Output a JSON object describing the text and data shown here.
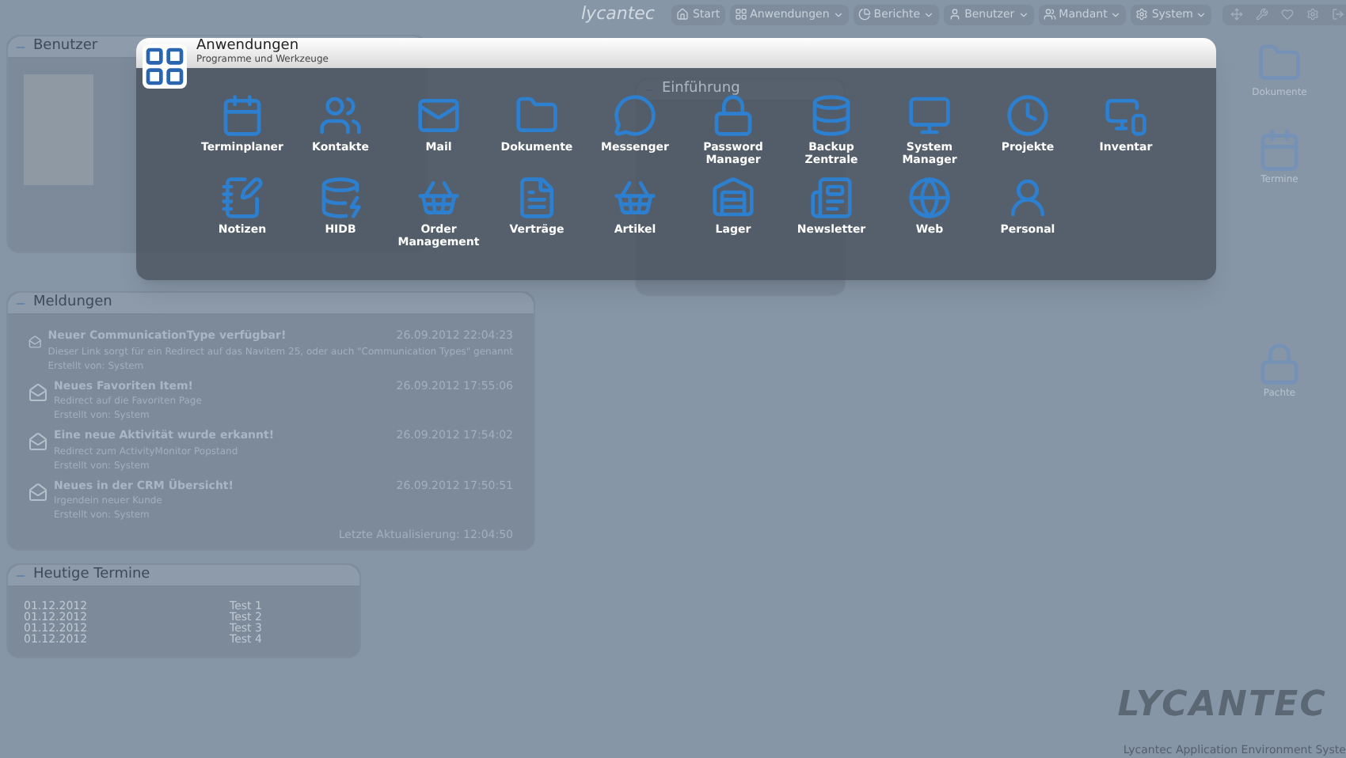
{
  "brand": "lycantec",
  "nav": [
    {
      "label": "Start",
      "menu": false
    },
    {
      "label": "Anwendungen",
      "menu": true
    },
    {
      "label": "Berichte",
      "menu": true
    },
    {
      "label": "Benutzer",
      "menu": true
    },
    {
      "label": "Mandant",
      "menu": true
    },
    {
      "label": "System",
      "menu": true
    }
  ],
  "user_panel": {
    "title": "Benutzer"
  },
  "intro_panel": {
    "title": "Einführung"
  },
  "messages_panel": {
    "title": "Meldungen",
    "items": [
      {
        "title": "Neuer CommunicationType verfügbar!",
        "date": "26.09.2012 22:04:23",
        "text": "Dieser Link sorgt für ein Redirect auf das Navitem 25, oder auch \"Communication Types\" genannt",
        "author": "Erstellt von: System"
      },
      {
        "title": "Neues Favoriten Item!",
        "date": "26.09.2012 17:55:06",
        "text": "Redirect auf die Favoriten Page",
        "author": "Erstellt von: System"
      },
      {
        "title": "Eine neue Aktivität wurde erkannt!",
        "date": "26.09.2012 17:54:02",
        "text": "Redirect zum ActivityMonitor Popstand",
        "author": "Erstellt von: System"
      },
      {
        "title": "Neues in der CRM Übersicht!",
        "date": "26.09.2012 17:50:51",
        "text": "Irgendein neuer Kunde",
        "author": "Erstellt von: System"
      }
    ],
    "footer": "Letzte Aktualisierung: 12:04:50"
  },
  "appointments_panel": {
    "title": "Heutige Termine",
    "rows": [
      {
        "date": "01.12.2012",
        "name": "Test 1"
      },
      {
        "date": "01.12.2012",
        "name": "Test 2"
      },
      {
        "date": "01.12.2012",
        "name": "Test 3"
      },
      {
        "date": "01.12.2012",
        "name": "Test 4"
      }
    ]
  },
  "desktop_icons": [
    {
      "label": "Dokumente"
    },
    {
      "label": "Termine"
    },
    {
      "label": "Pachte"
    }
  ],
  "applications": {
    "title": "Anwendungen",
    "subtitle": "Programme und Werkzeuge",
    "apps": [
      {
        "label": "Terminplaner"
      },
      {
        "label": "Kontakte"
      },
      {
        "label": "Mail"
      },
      {
        "label": "Dokumente"
      },
      {
        "label": "Messenger"
      },
      {
        "label": "Password Manager"
      },
      {
        "label": "Backup Zentrale"
      },
      {
        "label": "System Manager"
      },
      {
        "label": "Projekte"
      },
      {
        "label": "Inventar"
      },
      {
        "label": "Notizen"
      },
      {
        "label": "HIDB"
      },
      {
        "label": "Order Management"
      },
      {
        "label": "Verträge"
      },
      {
        "label": "Artikel"
      },
      {
        "label": "Lager"
      },
      {
        "label": "Newsletter"
      },
      {
        "label": "Web"
      },
      {
        "label": "Personal"
      }
    ]
  },
  "logo": "LYCANTEC",
  "status": "Lycantec Application Environment Syste"
}
